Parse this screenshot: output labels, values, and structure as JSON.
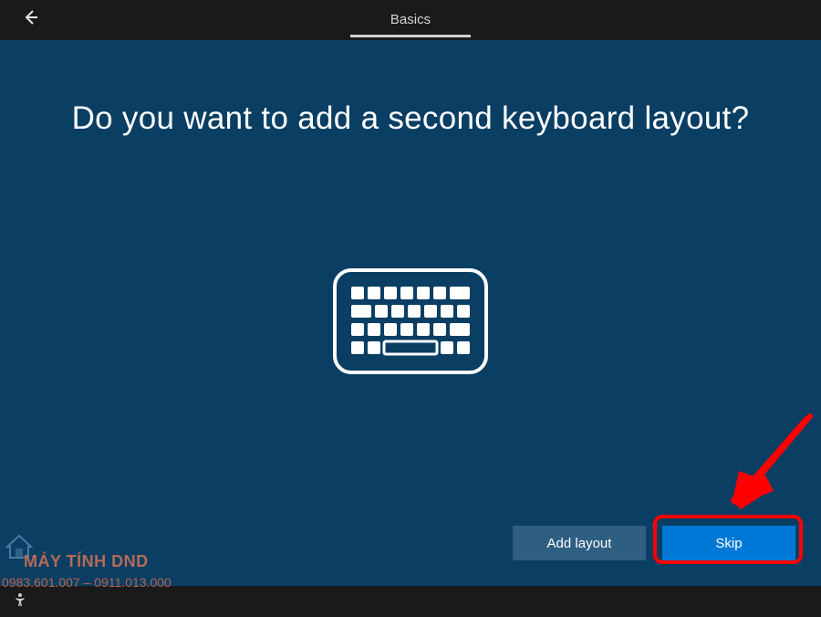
{
  "header": {
    "tab_label": "Basics"
  },
  "main": {
    "title": "Do you want to add a second keyboard layout?"
  },
  "buttons": {
    "add_layout": "Add layout",
    "skip": "Skip"
  },
  "watermark": {
    "brand": "MÁY TÍNH DND",
    "phone": "0983.601.007 – 0911.013.000"
  },
  "colors": {
    "background": "#0a3e63",
    "topbar": "#1a1a1a",
    "primary": "#0078d7",
    "annotation": "#ff0000"
  }
}
